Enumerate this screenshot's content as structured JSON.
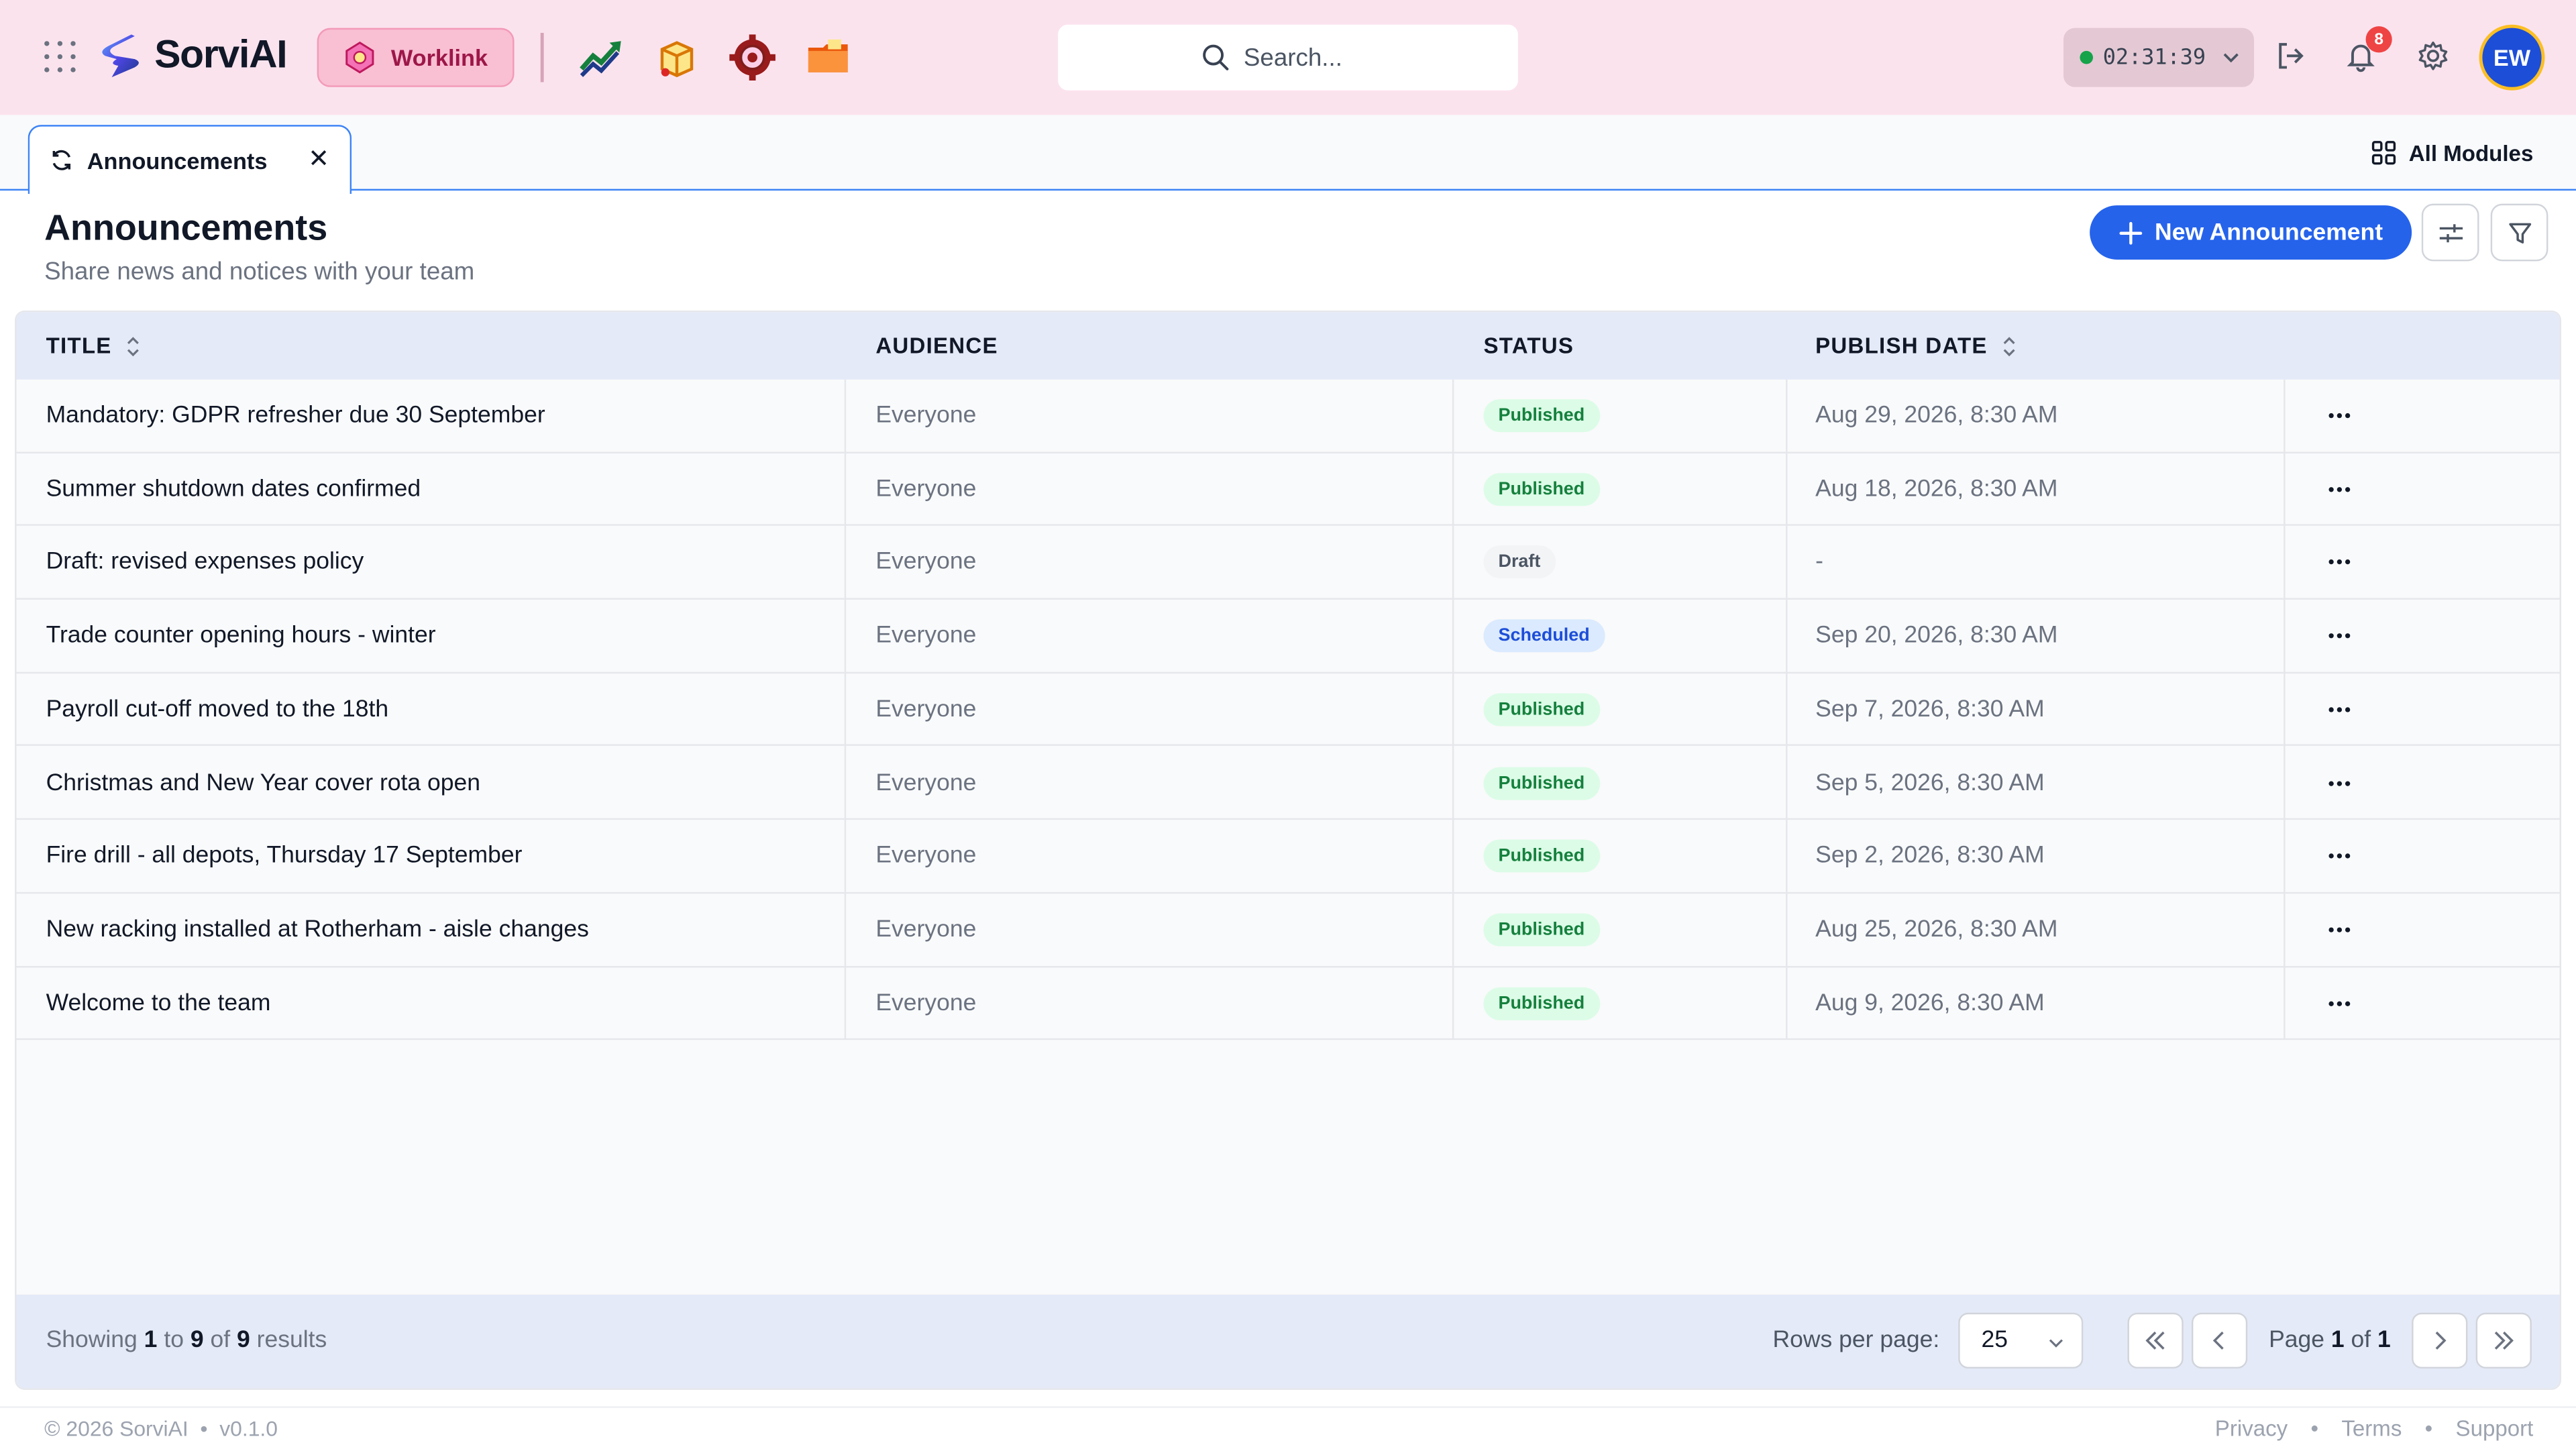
{
  "app": {
    "name": "SorviAI"
  },
  "header": {
    "module_label": "Worklink",
    "search_placeholder": "Search...",
    "timer": "02:31:39",
    "notification_count": "8",
    "avatar_initials": "EW",
    "icons": [
      "apps-grid-icon",
      "analytics-icon",
      "package-icon",
      "settings-gear-app-icon",
      "folder-icon",
      "logout-icon",
      "bell-icon",
      "gear-icon"
    ]
  },
  "tabs": {
    "active": "Announcements",
    "all_modules": "All Modules"
  },
  "page": {
    "title": "Announcements",
    "subtitle": "Share news and notices with your team",
    "new_button": "New Announcement"
  },
  "table": {
    "columns": [
      "TITLE",
      "AUDIENCE",
      "STATUS",
      "PUBLISH DATE"
    ],
    "rows": [
      {
        "title": "Mandatory: GDPR refresher due 30 September",
        "audience": "Everyone",
        "status": "Published",
        "date": "Aug 29, 2026, 8:30 AM"
      },
      {
        "title": "Summer shutdown dates confirmed",
        "audience": "Everyone",
        "status": "Published",
        "date": "Aug 18, 2026, 8:30 AM"
      },
      {
        "title": "Draft: revised expenses policy",
        "audience": "Everyone",
        "status": "Draft",
        "date": "-"
      },
      {
        "title": "Trade counter opening hours - winter",
        "audience": "Everyone",
        "status": "Scheduled",
        "date": "Sep 20, 2026, 8:30 AM"
      },
      {
        "title": "Payroll cut-off moved to the 18th",
        "audience": "Everyone",
        "status": "Published",
        "date": "Sep 7, 2026, 8:30 AM"
      },
      {
        "title": "Christmas and New Year cover rota open",
        "audience": "Everyone",
        "status": "Published",
        "date": "Sep 5, 2026, 8:30 AM"
      },
      {
        "title": "Fire drill - all depots, Thursday 17 September",
        "audience": "Everyone",
        "status": "Published",
        "date": "Sep 2, 2026, 8:30 AM"
      },
      {
        "title": "New racking installed at Rotherham - aisle changes",
        "audience": "Everyone",
        "status": "Published",
        "date": "Aug 25, 2026, 8:30 AM"
      },
      {
        "title": "Welcome to the team",
        "audience": "Everyone",
        "status": "Published",
        "date": "Aug 9, 2026, 8:30 AM"
      }
    ]
  },
  "pagination": {
    "showing_prefix": "Showing",
    "from": "1",
    "to_word": "to",
    "to": "9",
    "of_word": "of",
    "total": "9",
    "results_word": "results",
    "rows_per_page_label": "Rows per page:",
    "rows_per_page": "25",
    "page_word": "Page",
    "page": "1",
    "page_of": "of",
    "pages": "1"
  },
  "footer": {
    "copyright": "© 2026 SorviAI",
    "version": "v0.1.0",
    "links": [
      "Privacy",
      "Terms",
      "Support"
    ]
  },
  "colors": {
    "accent": "#2563eb",
    "topbar_bg": "#fbe3ee",
    "published": "#15803d",
    "scheduled": "#1d4ed8"
  }
}
